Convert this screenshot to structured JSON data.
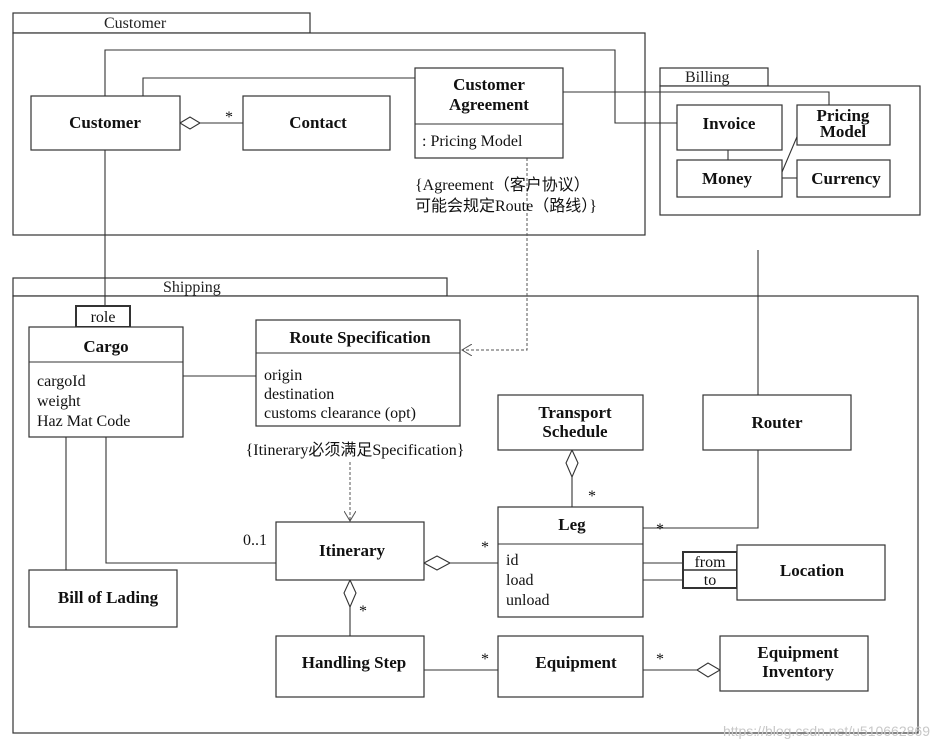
{
  "packages": {
    "customer": "Customer",
    "billing": "Billing",
    "shipping": "Shipping"
  },
  "classes": {
    "customer": "Customer",
    "contact": "Contact",
    "customer_agreement": [
      "Customer",
      "Agreement"
    ],
    "customer_agreement_attr": ": Pricing Model",
    "invoice": "Invoice",
    "pricing_model": [
      "Pricing",
      "Model"
    ],
    "money": "Money",
    "currency": "Currency",
    "cargo": "Cargo",
    "cargo_attrs": [
      "cargoId",
      "weight",
      "Haz Mat Code"
    ],
    "route_spec": "Route Specification",
    "route_spec_attrs": [
      "origin",
      "destination",
      "customs clearance (opt)"
    ],
    "transport_schedule": [
      "Transport",
      "Schedule"
    ],
    "router": "Router",
    "leg": "Leg",
    "leg_attrs": [
      "id",
      "load",
      "unload"
    ],
    "itinerary": "Itinerary",
    "bill_of_lading": "Bill of Lading",
    "location": "Location",
    "handling_step": "Handling Step",
    "equipment": "Equipment",
    "equipment_inventory": [
      "Equipment",
      "Inventory"
    ]
  },
  "qualifiers": {
    "role": "role",
    "from": "from",
    "to": "to"
  },
  "notes": {
    "agreement": [
      "{Agreement（客户协议）",
      "可能会规定Route（路线）}"
    ],
    "itinerary": "{Itinerary必须满足Specification}"
  },
  "multiplicities": {
    "many": "*",
    "zero_one": "0..1"
  },
  "watermark": "https://blog.csdn.net/u510662869"
}
